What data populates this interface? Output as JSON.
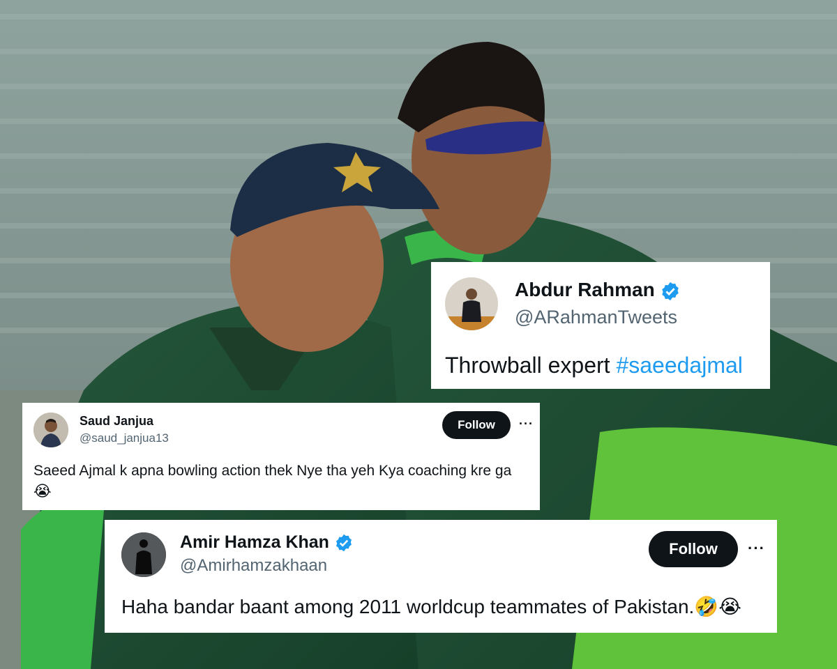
{
  "background": {
    "description_icon": "cricket-players-photo",
    "accent_green": "#39b54a",
    "kit_green": "#1f4a2c"
  },
  "tweets": [
    {
      "name": "Abdur Rahman",
      "handle": "@ARahmanTweets",
      "verified": true,
      "text": "Throwball expert ",
      "hashtag": "#saeedajmal"
    },
    {
      "name": "Saud Janjua",
      "handle": "@saud_janjua13",
      "verified": false,
      "follow_label": "Follow",
      "more_label": "···",
      "text": "Saeed Ajmal k apna bowling action thek Nye tha yeh Kya coaching kre ga",
      "emoji": "😭"
    },
    {
      "name": "Amir Hamza Khan",
      "handle": "@Amirhamzakhaan",
      "verified": true,
      "follow_label": "Follow",
      "more_label": "···",
      "text": "Haha bandar baant among 2011 worldcup teammates of Pakistan.",
      "emoji": "🤣😭"
    }
  ],
  "colors": {
    "verified": "#1d9bf0",
    "hashtag": "#1d9bf0",
    "handle": "#536471",
    "follow_bg": "#0f1419"
  }
}
